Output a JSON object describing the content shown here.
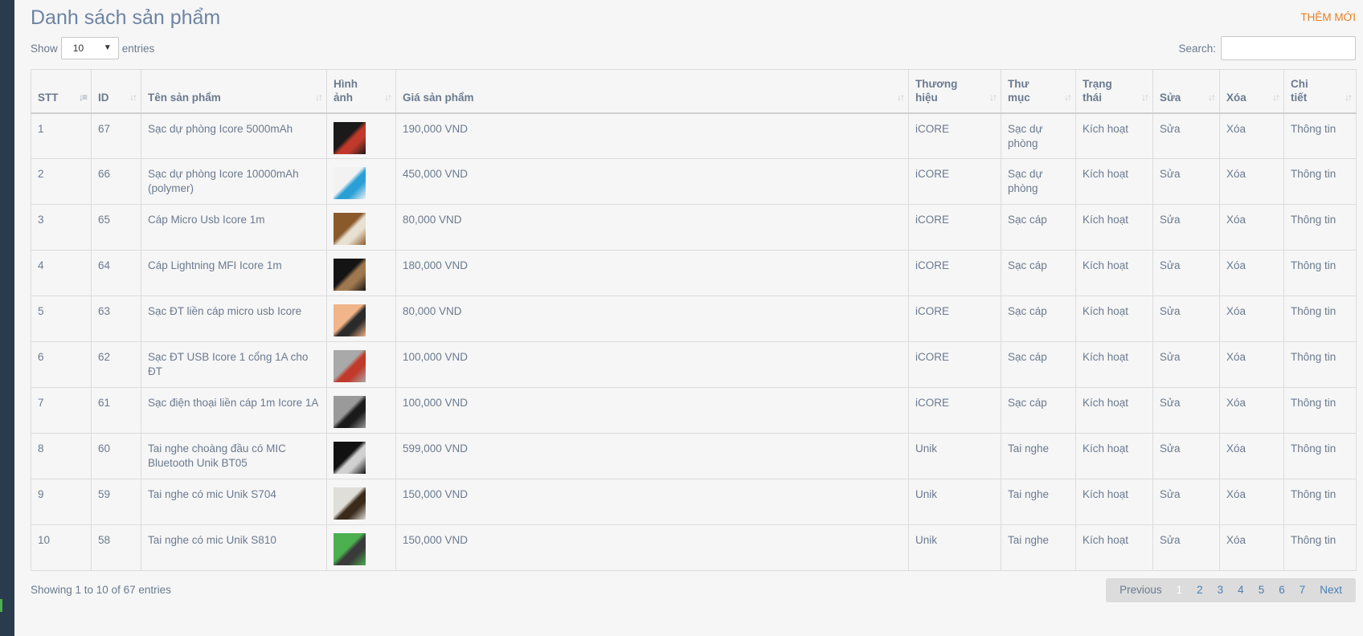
{
  "page": {
    "title": "Danh sách sản phẩm",
    "add_new": "THÊM MỚI"
  },
  "length": {
    "show_label": "Show",
    "value": "10",
    "entries_label": "entries"
  },
  "search": {
    "label": "Search:",
    "value": "",
    "placeholder": ""
  },
  "table": {
    "headers": [
      {
        "line1": "STT",
        "line2": ""
      },
      {
        "line1": "ID",
        "line2": ""
      },
      {
        "line1": "Tên sản phẩm",
        "line2": ""
      },
      {
        "line1": "Hình",
        "line2": "ảnh"
      },
      {
        "line1": "Giá sản phẩm",
        "line2": ""
      },
      {
        "line1": "Thương",
        "line2": "hiệu"
      },
      {
        "line1": "Thư",
        "line2": "mục"
      },
      {
        "line1": "Trạng",
        "line2": "thái"
      },
      {
        "line1": "Sửa",
        "line2": ""
      },
      {
        "line1": "Xóa",
        "line2": ""
      },
      {
        "line1": "Chi",
        "line2": "tiết"
      }
    ],
    "rows": [
      {
        "stt": "1",
        "id": "67",
        "name": "Sạc dự phòng Icore 5000mAh",
        "price": "190,000 VND",
        "brand": "iCORE",
        "category": "Sạc dự phòng",
        "status": "Kích hoạt",
        "edit": "Sửa",
        "delete": "Xóa",
        "detail": "Thông tin"
      },
      {
        "stt": "2",
        "id": "66",
        "name": "Sạc dự phòng Icore 10000mAh (polymer)",
        "price": "450,000 VND",
        "brand": "iCORE",
        "category": "Sạc dự phòng",
        "status": "Kích hoạt",
        "edit": "Sửa",
        "delete": "Xóa",
        "detail": "Thông tin"
      },
      {
        "stt": "3",
        "id": "65",
        "name": "Cáp Micro Usb Icore 1m",
        "price": "80,000 VND",
        "brand": "iCORE",
        "category": "Sạc cáp",
        "status": "Kích hoạt",
        "edit": "Sửa",
        "delete": "Xóa",
        "detail": "Thông tin"
      },
      {
        "stt": "4",
        "id": "64",
        "name": "Cáp Lightning MFI Icore 1m",
        "price": "180,000 VND",
        "brand": "iCORE",
        "category": "Sạc cáp",
        "status": "Kích hoạt",
        "edit": "Sửa",
        "delete": "Xóa",
        "detail": "Thông tin"
      },
      {
        "stt": "5",
        "id": "63",
        "name": "Sạc ĐT liền cáp micro usb Icore",
        "price": "80,000 VND",
        "brand": "iCORE",
        "category": "Sạc cáp",
        "status": "Kích hoạt",
        "edit": "Sửa",
        "delete": "Xóa",
        "detail": "Thông tin"
      },
      {
        "stt": "6",
        "id": "62",
        "name": "Sạc ĐT USB Icore 1 cổng 1A cho ĐT",
        "price": "100,000 VND",
        "brand": "iCORE",
        "category": "Sạc cáp",
        "status": "Kích hoạt",
        "edit": "Sửa",
        "delete": "Xóa",
        "detail": "Thông tin"
      },
      {
        "stt": "7",
        "id": "61",
        "name": "Sạc điện thoại liền cáp 1m Icore 1A",
        "price": "100,000 VND",
        "brand": "iCORE",
        "category": "Sạc cáp",
        "status": "Kích hoạt",
        "edit": "Sửa",
        "delete": "Xóa",
        "detail": "Thông tin"
      },
      {
        "stt": "8",
        "id": "60",
        "name": "Tai nghe choàng đầu có MIC Bluetooth Unik BT05",
        "price": "599,000 VND",
        "brand": "Unik",
        "category": "Tai nghe",
        "status": "Kích hoạt",
        "edit": "Sửa",
        "delete": "Xóa",
        "detail": "Thông tin"
      },
      {
        "stt": "9",
        "id": "59",
        "name": "Tai nghe có mic Unik S704",
        "price": "150,000 VND",
        "brand": "Unik",
        "category": "Tai nghe",
        "status": "Kích hoạt",
        "edit": "Sửa",
        "delete": "Xóa",
        "detail": "Thông tin"
      },
      {
        "stt": "10",
        "id": "58",
        "name": "Tai nghe có mic Unik S810",
        "price": "150,000 VND",
        "brand": "Unik",
        "category": "Tai nghe",
        "status": "Kích hoạt",
        "edit": "Sửa",
        "delete": "Xóa",
        "detail": "Thông tin"
      }
    ]
  },
  "footer": {
    "showing": "Showing 1 to 10 of 67 entries",
    "previous": "Previous",
    "pages": [
      "1",
      "2",
      "3",
      "4",
      "5",
      "6",
      "7"
    ],
    "next": "Next"
  },
  "colors": {
    "sidebar": "#2b3b4e",
    "accent_orange": "#e67e22",
    "link_blue": "#4a7fb5"
  }
}
